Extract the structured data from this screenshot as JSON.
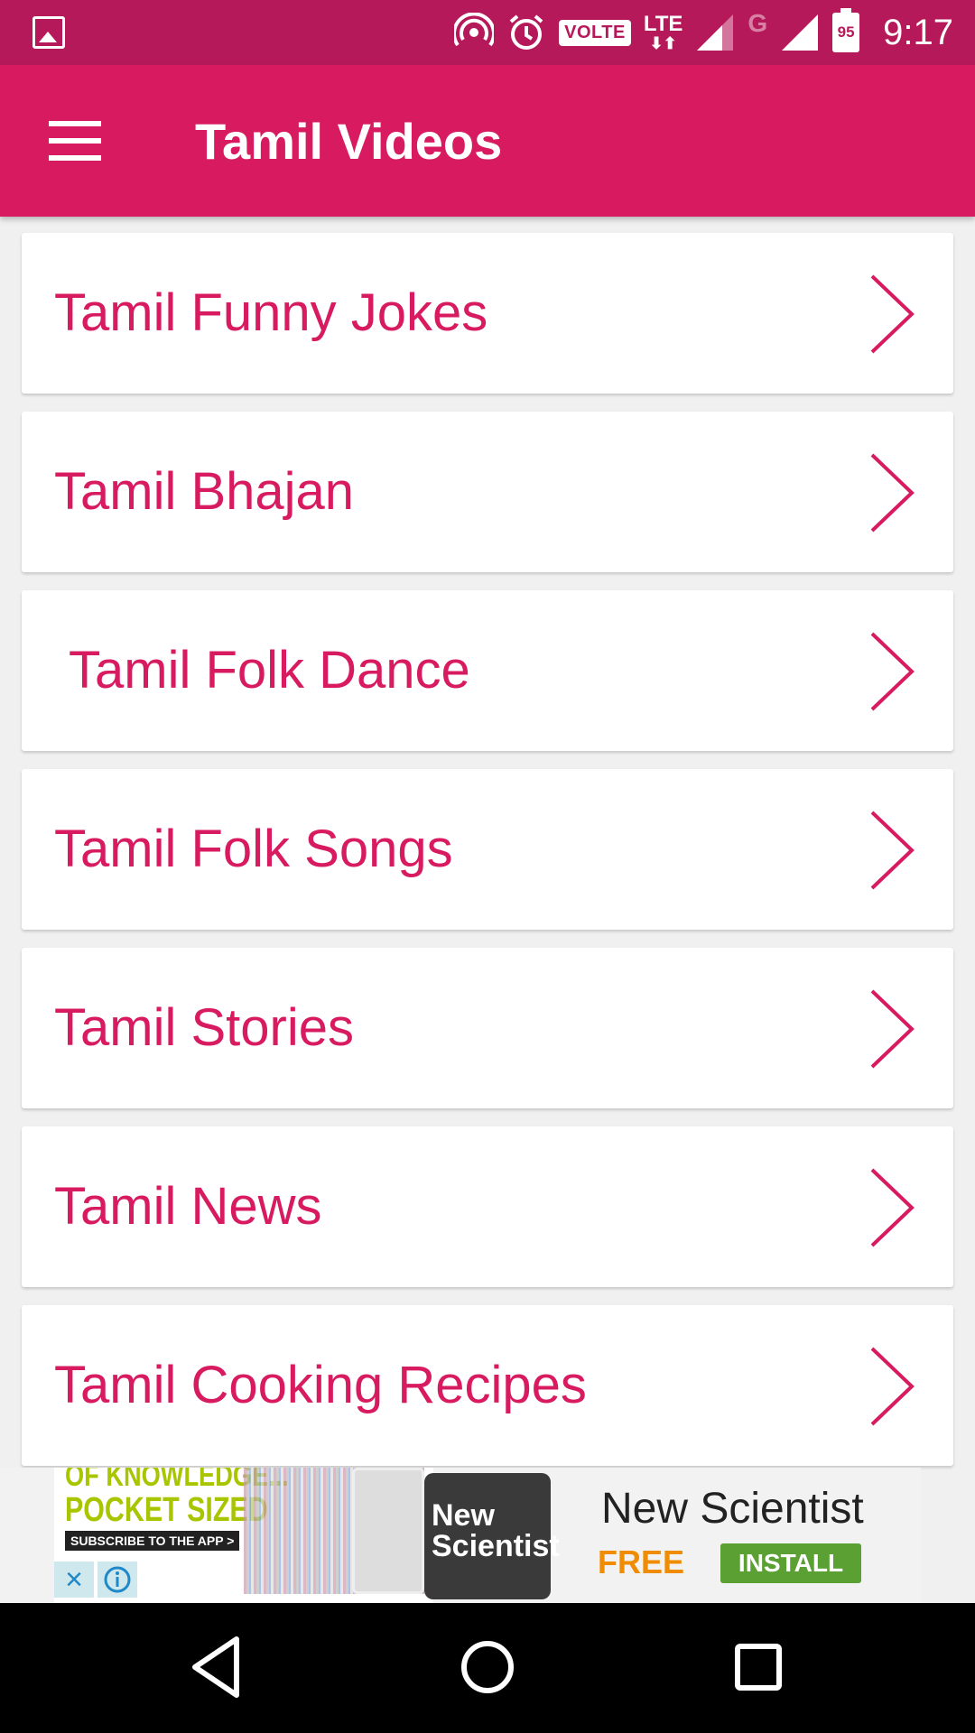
{
  "status_bar": {
    "volte": "VOLTE",
    "lte": "LTE",
    "g": "G",
    "battery": "95",
    "time": "9:17"
  },
  "app_bar": {
    "title": "Tamil Videos"
  },
  "list": {
    "items": [
      {
        "label": "Tamil Funny Jokes"
      },
      {
        "label": "Tamil Bhajan"
      },
      {
        "label": "Tamil Folk Dance"
      },
      {
        "label": "Tamil Folk Songs"
      },
      {
        "label": "Tamil Stories"
      },
      {
        "label": "Tamil News"
      },
      {
        "label": "Tamil Cooking Recipes"
      }
    ]
  },
  "ad": {
    "tagline_1": "OF KNOWLEDGE...",
    "tagline_2": "POCKET SIZED",
    "subscribe": "SUBSCRIBE TO THE APP >",
    "logo": "New Scientist",
    "app_name": "New Scientist",
    "price": "FREE",
    "install": "INSTALL"
  },
  "colors": {
    "status_bar": "#b6195a",
    "app_bar": "#d81b60",
    "accent_text": "#d81b60",
    "install_button": "#5ba033",
    "free_text": "#f08c00"
  }
}
